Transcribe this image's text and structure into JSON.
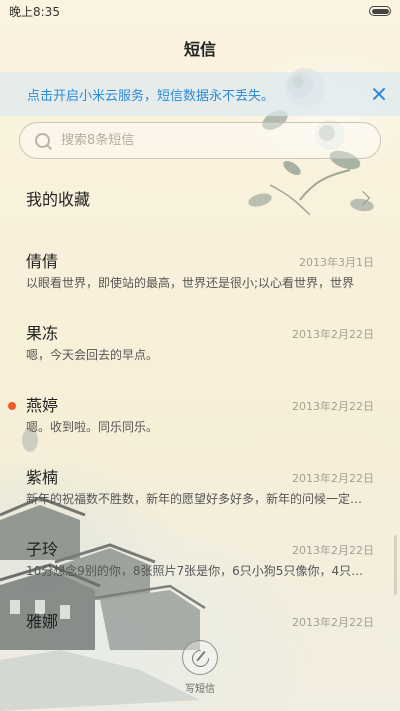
{
  "status_bar": {
    "time": "晚上8:35"
  },
  "header": {
    "title": "短信"
  },
  "banner": {
    "text": "点击开启小米云服务，短信数据永不丢失。"
  },
  "search": {
    "placeholder": "搜索8条短信"
  },
  "favorites": {
    "label": "我的收藏"
  },
  "messages": [
    {
      "name": "倩倩",
      "date": "2013年3月1日",
      "preview": "以眼看世界，即使站的最高，世界还是很小;以心看世界，世界",
      "unread": false
    },
    {
      "name": "果冻",
      "date": "2013年2月22日",
      "preview": "嗯，今天会回去的早点。",
      "unread": false
    },
    {
      "name": "燕婷",
      "date": "2013年2月22日",
      "preview": "嗯。收到啦。同乐同乐。",
      "unread": true
    },
    {
      "name": "紫楠",
      "date": "2013年2月22日",
      "preview": "新年的祝福数不胜数，新年的愿望好多好多，新年的问候一定要送",
      "unread": false
    },
    {
      "name": "子玲",
      "date": "2013年2月22日",
      "preview": "10分想念9别的你，8张照片7张是你，6只小狗5只像你，4只蜜蜂",
      "unread": false
    },
    {
      "name": "雅娜",
      "date": "2013年2月22日",
      "preview": "",
      "unread": false
    }
  ],
  "compose": {
    "label": "写短信"
  },
  "icons": {
    "search": "search-icon",
    "close": "close-icon",
    "chevron": "chevron-right-icon",
    "compose": "compose-icon",
    "battery": "battery-icon"
  },
  "colors": {
    "accent": "#2a8bd8",
    "unread": "#ef5a28",
    "background": "#f8f1dc"
  }
}
